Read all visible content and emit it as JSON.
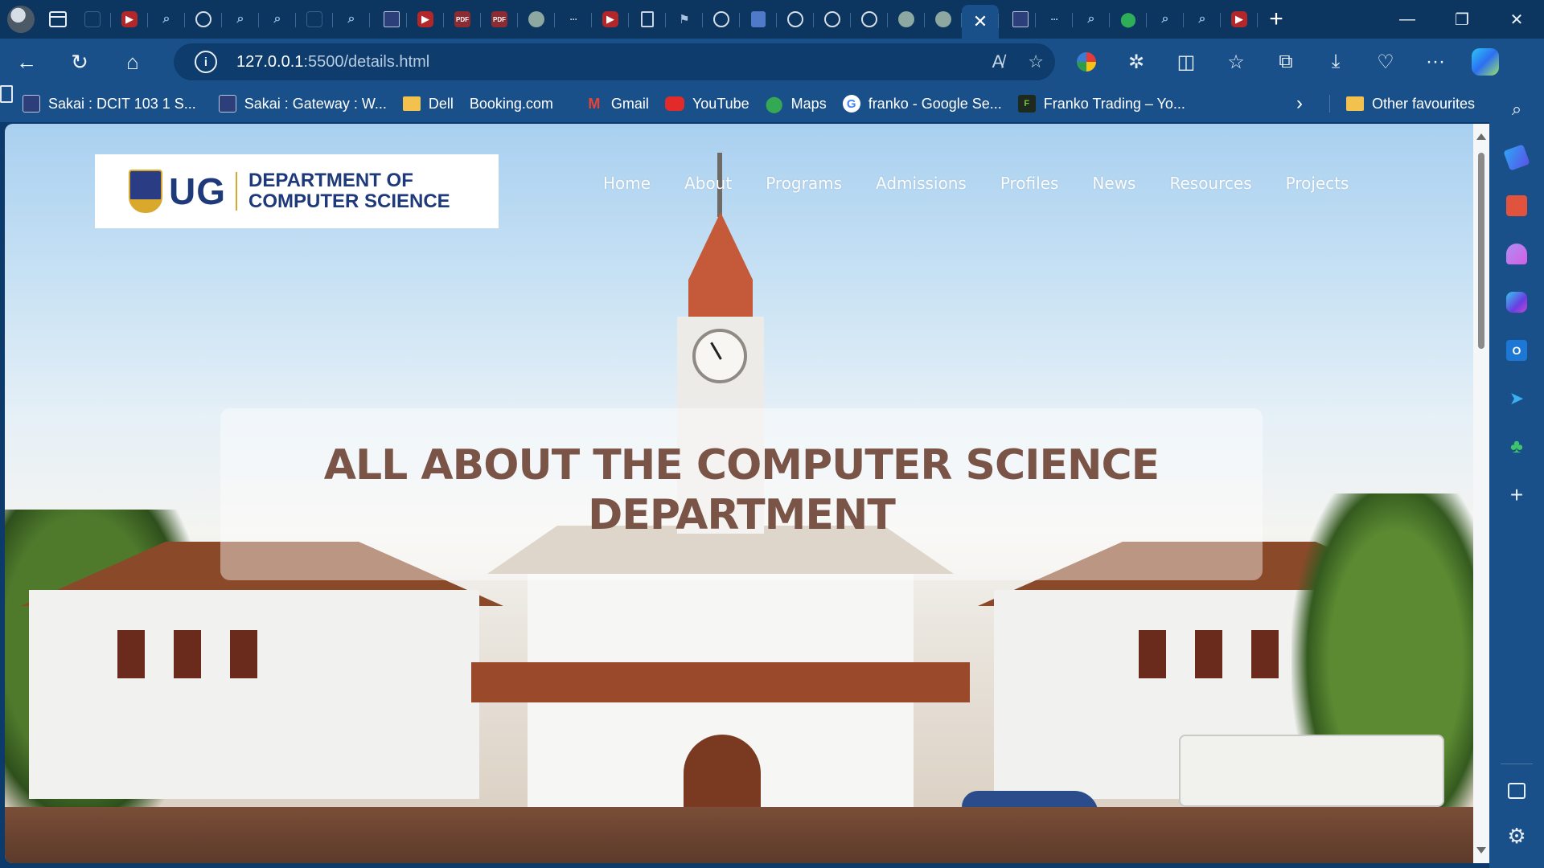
{
  "browser": {
    "tabs": [
      {
        "icon": "blank-icon"
      },
      {
        "icon": "youtube-icon"
      },
      {
        "icon": "search-icon"
      },
      {
        "icon": "github-icon"
      },
      {
        "icon": "search-icon"
      },
      {
        "icon": "search-icon"
      },
      {
        "icon": "blank-icon"
      },
      {
        "icon": "search-icon"
      },
      {
        "icon": "ug-icon"
      },
      {
        "icon": "youtube-icon"
      },
      {
        "icon": "pdf-icon"
      },
      {
        "icon": "pdf-icon"
      },
      {
        "icon": "chatgpt-icon"
      },
      {
        "icon": "more-icon"
      },
      {
        "icon": "youtube-icon"
      },
      {
        "icon": "document-icon"
      },
      {
        "icon": "flag-icon"
      },
      {
        "icon": "github-icon"
      },
      {
        "icon": "google-docs-icon"
      },
      {
        "icon": "github-icon"
      },
      {
        "icon": "github-icon"
      },
      {
        "icon": "github-icon"
      },
      {
        "icon": "chatgpt-icon"
      },
      {
        "icon": "chatgpt-icon"
      },
      {
        "icon": "close-icon",
        "active": true
      },
      {
        "icon": "ug-icon"
      },
      {
        "icon": "more-icon"
      },
      {
        "icon": "search-icon"
      },
      {
        "icon": "maps-icon"
      },
      {
        "icon": "search-icon"
      },
      {
        "icon": "search-icon"
      },
      {
        "icon": "youtube-icon"
      }
    ],
    "address": {
      "host": "127.0.0.1",
      "path": ":5500/details.html"
    },
    "favorites": [
      {
        "label": "Sakai : DCIT 103 1 S...",
        "icon": "ug-icon"
      },
      {
        "label": "Sakai : Gateway : W...",
        "icon": "ug-icon"
      },
      {
        "label": "Dell",
        "icon": "folder-icon"
      },
      {
        "label": "Booking.com",
        "icon": "page-icon"
      },
      {
        "label": "",
        "icon": "page-icon"
      },
      {
        "label": "Gmail",
        "icon": "gmail-icon"
      },
      {
        "label": "YouTube",
        "icon": "youtube-icon"
      },
      {
        "label": "Maps",
        "icon": "maps-icon"
      },
      {
        "label": "franko - Google Se...",
        "icon": "google-icon"
      },
      {
        "label": "Franko Trading – Yo...",
        "icon": "franko-icon"
      }
    ],
    "other_favourites": "Other favourites"
  },
  "site": {
    "logo_ug": "UG",
    "dept_line1": "DEPARTMENT OF",
    "dept_line2": "COMPUTER SCIENCE",
    "nav": [
      "Home",
      "About",
      "Programs",
      "Admissions",
      "Profiles",
      "News",
      "Resources",
      "Projects"
    ],
    "hero_title_line1": "ALL ABOUT THE COMPUTER SCIENCE",
    "hero_title_line2": "DEPARTMENT"
  },
  "colors": {
    "browser_frame": "#1a5089",
    "tabstrip": "#0c3560",
    "brand_blue": "#1f3a7a",
    "hero_text": "#7a5547"
  }
}
